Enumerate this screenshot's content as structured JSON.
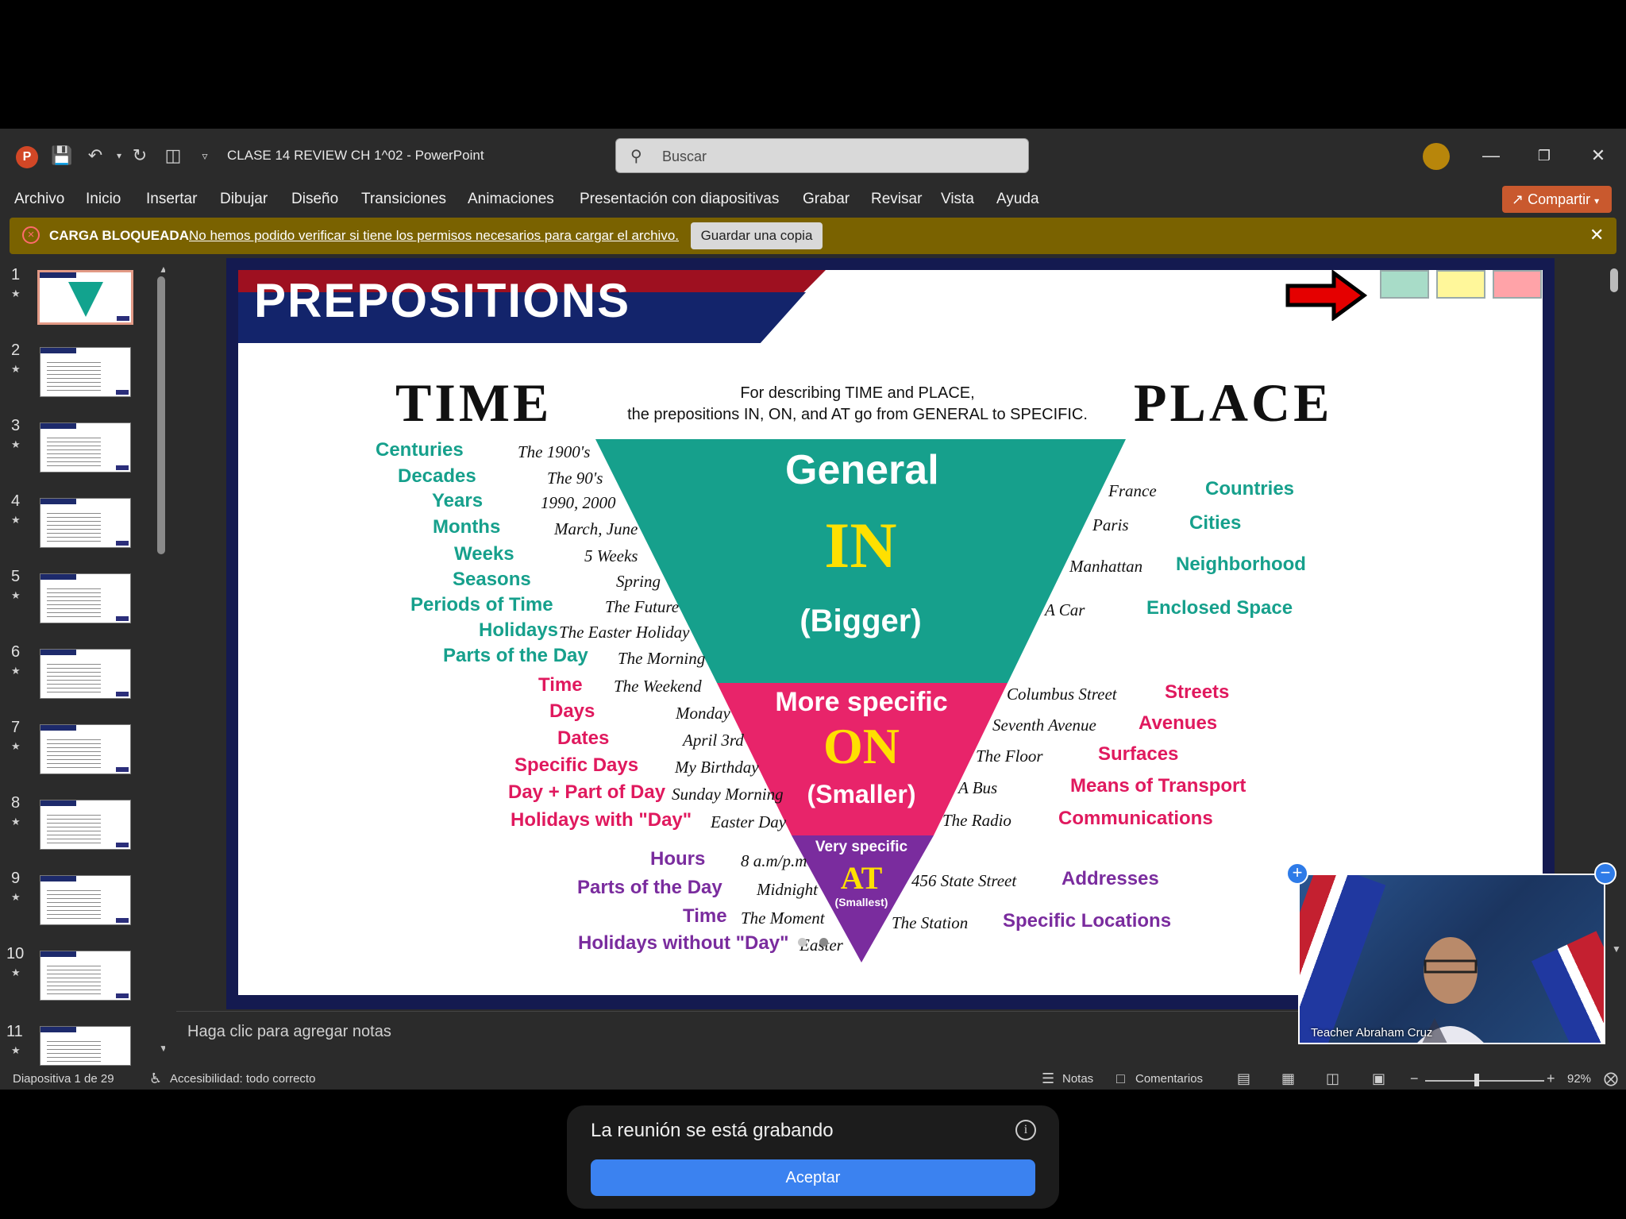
{
  "window": {
    "doc_title": "CLASE 14 REVIEW CH 1^02  -  PowerPoint",
    "search_placeholder": "Buscar"
  },
  "menu": {
    "items": [
      "Archivo",
      "Inicio",
      "Insertar",
      "Dibujar",
      "Diseño",
      "Transiciones",
      "Animaciones",
      "Presentación con diapositivas",
      "Grabar",
      "Revisar",
      "Vista",
      "Ayuda"
    ],
    "share_label": "Compartir"
  },
  "infobar": {
    "title": "CARGA BLOQUEADA",
    "message": "No hemos podido verificar si tiene los permisos necesarios para cargar el archivo.",
    "button": "Guardar una copia"
  },
  "thumbnails": {
    "numbers": [
      "1",
      "2",
      "3",
      "4",
      "5",
      "6",
      "7",
      "8",
      "9",
      "10",
      "11"
    ],
    "star": "★"
  },
  "slide": {
    "title": "PREPOSITIONS",
    "time_heading": "TIME",
    "place_heading": "PLACE",
    "desc_line1": "For describing TIME and PLACE,",
    "desc_line2": "the prepositions IN, ON, and AT go from GENERAL to SPECIFIC.",
    "swatch_colors": [
      "#a8dcc8",
      "#fff79a",
      "#ffa3a8"
    ],
    "colors": {
      "teal": "#16a08c",
      "pink": "#e8246a",
      "purple": "#7a2c9e",
      "navy": "#13246b",
      "red": "#9e1020"
    },
    "pyramid": {
      "in": {
        "top": "General",
        "word": "IN",
        "sub": "(Bigger)"
      },
      "on": {
        "top": "More specific",
        "word": "ON",
        "sub": "(Smaller)"
      },
      "at": {
        "top": "Very specific",
        "word": "AT",
        "sub": "(Smallest)"
      }
    },
    "time_in": [
      {
        "label": "Centuries",
        "example": "The 1900's"
      },
      {
        "label": "Decades",
        "example": "The 90's"
      },
      {
        "label": "Years",
        "example": "1990, 2000"
      },
      {
        "label": "Months",
        "example": "March, June"
      },
      {
        "label": "Weeks",
        "example": "5 Weeks"
      },
      {
        "label": "Seasons",
        "example": "Spring"
      },
      {
        "label": "Periods of Time",
        "example": "The Future"
      },
      {
        "label": "Holidays",
        "example": "The Easter Holiday"
      },
      {
        "label": "Parts of the Day",
        "example": "The Morning"
      }
    ],
    "time_on": [
      {
        "label": "Time",
        "example": "The Weekend"
      },
      {
        "label": "Days",
        "example": "Monday"
      },
      {
        "label": "Dates",
        "example": "April 3rd"
      },
      {
        "label": "Specific Days",
        "example": "My Birthday"
      },
      {
        "label": "Day + Part of Day",
        "example": "Sunday Morning"
      },
      {
        "label": "Holidays with \"Day\"",
        "example": "Easter Day"
      }
    ],
    "time_at": [
      {
        "label": "Hours",
        "example": "8 a.m/p.m"
      },
      {
        "label": "Parts of the Day",
        "example": "Midnight"
      },
      {
        "label": "Time",
        "example": "The Moment"
      },
      {
        "label": "Holidays without \"Day\"",
        "example": "Easter"
      }
    ],
    "place_in": [
      {
        "example": "France",
        "label": "Countries"
      },
      {
        "example": "Paris",
        "label": "Cities"
      },
      {
        "example": "Manhattan",
        "label": "Neighborhood"
      },
      {
        "example": "A Car",
        "label": "Enclosed Space"
      }
    ],
    "place_on": [
      {
        "example": "Columbus Street",
        "label": "Streets"
      },
      {
        "example": "Seventh Avenue",
        "label": "Avenues"
      },
      {
        "example": "The Floor",
        "label": "Surfaces"
      },
      {
        "example": "A Bus",
        "label": "Means of Transport"
      },
      {
        "example": "The Radio",
        "label": "Communications"
      }
    ],
    "place_at": [
      {
        "example": "456 State Street",
        "label": "Addresses"
      },
      {
        "example": "The Station",
        "label": "Specific Locations"
      }
    ]
  },
  "notes": {
    "placeholder": "Haga clic para agregar notas"
  },
  "status": {
    "slide_counter": "Diapositiva 1 de 29",
    "accessibility": "Accesibilidad: todo correcto",
    "notes": "Notas",
    "comments": "Comentarios",
    "zoom": "92%"
  },
  "video": {
    "name": "Teacher Abraham Cruz"
  },
  "toast": {
    "message": "La reunión se está grabando",
    "button": "Aceptar"
  }
}
